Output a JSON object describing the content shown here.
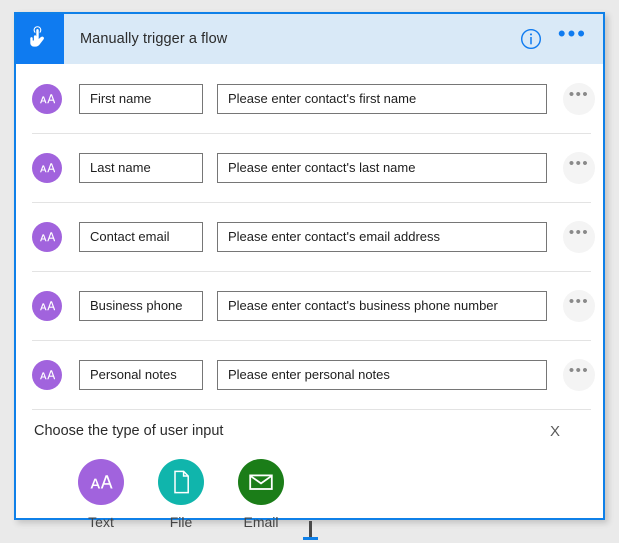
{
  "card": {
    "header": {
      "icon": "hand-tap-icon",
      "title": "Manually trigger a flow",
      "info_icon": "info-circle-icon",
      "menu_icon": "ellipsis-icon",
      "background_color": "#d9e9f7",
      "icon_tile_color": "#0f7bf0",
      "accent_color": "#0f80e8"
    },
    "fields": [
      {
        "avatar_icon": "text-type-icon",
        "avatar_glyph": "AÅ",
        "name": "First name",
        "description": "Please enter contact's first name",
        "menu_icon": "ellipsis-icon",
        "menu_glyph": "•••"
      },
      {
        "avatar_icon": "text-type-icon",
        "avatar_glyph": "AÅ",
        "name": "Last name",
        "description": "Please enter contact's last name",
        "menu_icon": "ellipsis-icon",
        "menu_glyph": "•••"
      },
      {
        "avatar_icon": "text-type-icon",
        "avatar_glyph": "AÅ",
        "name": "Contact email",
        "description": "Please enter contact's email address",
        "menu_icon": "ellipsis-icon",
        "menu_glyph": "•••"
      },
      {
        "avatar_icon": "text-type-icon",
        "avatar_glyph": "AÅ",
        "name": "Business phone",
        "description": "Please enter contact's business phone number",
        "menu_icon": "ellipsis-icon",
        "menu_glyph": "•••"
      },
      {
        "avatar_icon": "text-type-icon",
        "avatar_glyph": "AÅ",
        "name": "Personal notes",
        "description": "Please enter personal notes",
        "menu_icon": "ellipsis-icon",
        "menu_glyph": "•••"
      }
    ],
    "input_type_picker": {
      "title": "Choose the type of user input",
      "close_label": "X",
      "options": [
        {
          "label": "Text",
          "icon": "text-aa-icon",
          "color": "#a163dd"
        },
        {
          "label": "File",
          "icon": "document-icon",
          "color": "#10b5ac"
        },
        {
          "label": "Email",
          "icon": "envelope-icon",
          "color": "#1b7d18"
        }
      ]
    }
  },
  "colors": {
    "avatar_purple": "#a163dd",
    "card_border_blue": "#0f80e8",
    "page_background": "#eaeaea"
  }
}
